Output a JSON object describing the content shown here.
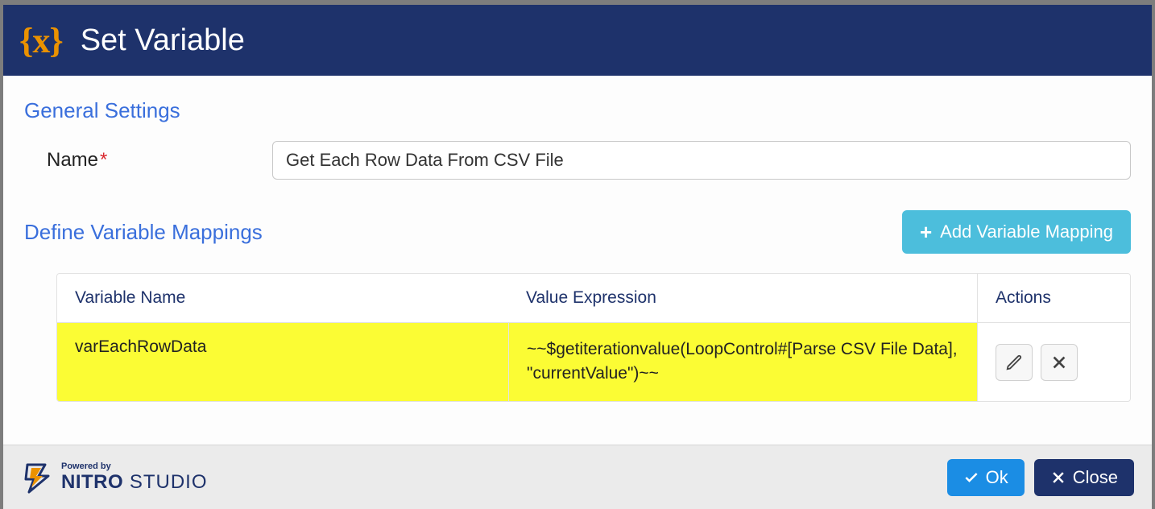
{
  "header": {
    "icon_text": "{x}",
    "title": "Set Variable"
  },
  "sections": {
    "general_label": "General Settings",
    "name_label": "Name",
    "required_mark": "*",
    "name_value": "Get Each Row Data From CSV File",
    "mappings_label": "Define Variable Mappings",
    "add_button": "Add Variable Mapping"
  },
  "table": {
    "columns": {
      "c1": "Variable Name",
      "c2": "Value Expression",
      "c3": "Actions"
    },
    "rows": [
      {
        "variable": "varEachRowData",
        "expression": "~~$getiterationvalue(LoopControl#[Parse CSV File Data], \"currentValue\")~~"
      }
    ]
  },
  "footer": {
    "powered_by": "Powered by",
    "brand_bold": "NITRO",
    "brand_light": " STUDIO",
    "ok": "Ok",
    "close": "Close"
  }
}
